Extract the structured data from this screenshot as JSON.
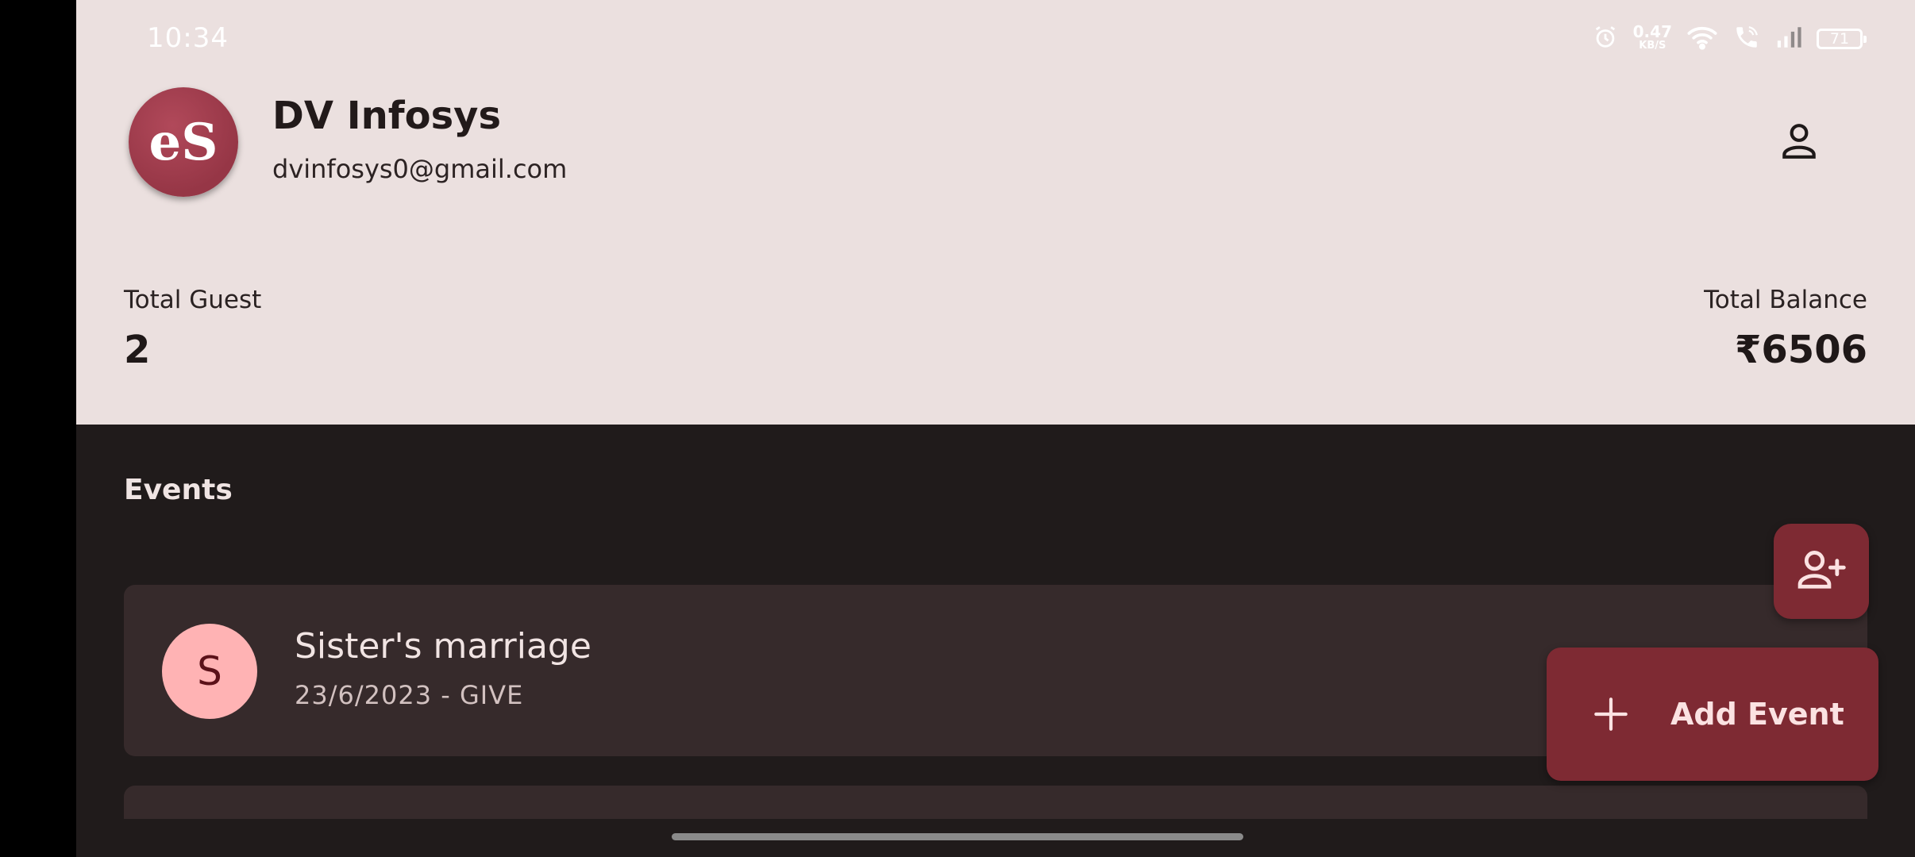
{
  "status_bar": {
    "time": "10:34",
    "net_speed": "0.47",
    "net_unit": "KB/S",
    "battery": "71",
    "icons": [
      "alarm-icon",
      "wifi-icon",
      "wifi-call-icon",
      "signal-icon",
      "battery-icon"
    ]
  },
  "profile": {
    "avatar_text": "eS",
    "name": "DV Infosys",
    "email": "dvinfosys0@gmail.com",
    "profile_icon": "person-icon"
  },
  "stats": {
    "guest_label": "Total Guest",
    "guest_value": "2",
    "balance_label": "Total Balance",
    "balance_value": "₹6506"
  },
  "events": {
    "title": "Events",
    "items": [
      {
        "initial": "S",
        "name": "Sister's marriage",
        "subtitle": "23/6/2023 - GIVE"
      }
    ]
  },
  "fabs": {
    "add_guest_icon": "person-add-icon",
    "add_event_label": "Add Event",
    "add_event_icon": "plus-icon"
  },
  "colors": {
    "header_bg": "#ebe0df",
    "body_bg": "#201b1b",
    "card_bg": "#362a2b",
    "accent": "#7e2a33",
    "event_avatar_bg": "#ffb3b4"
  }
}
